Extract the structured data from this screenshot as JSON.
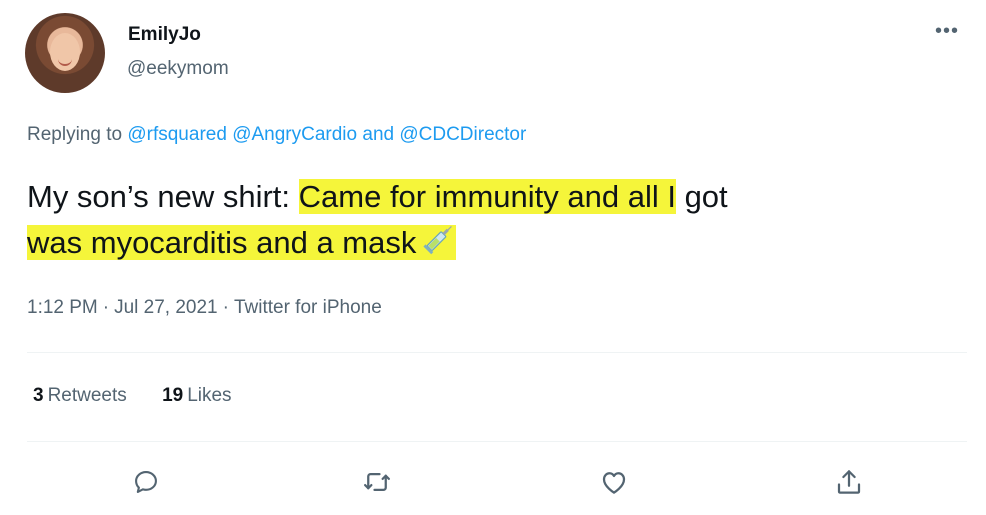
{
  "user": {
    "display_name": "EmilyJo",
    "handle": "@eekymom"
  },
  "more_icon": "more-horizontal-icon",
  "replying": {
    "prefix": "Replying to",
    "mentions": [
      "@rfsquared",
      "@AngryCardio",
      "@CDCDirector"
    ],
    "joiner": "and"
  },
  "tweet": {
    "text_plain": "My son’s new shirt: ",
    "text_highlighted_1": "Came for immunity and all I",
    "text_after_1": " got",
    "text_highlighted_2": "was myocarditis and a mask",
    "emoji": "syringe-icon",
    "highlight_color": "#f5f53a"
  },
  "meta": {
    "time": "1:12 PM",
    "date": "Jul 27, 2021",
    "source": "Twitter for iPhone",
    "separator": "·"
  },
  "stats": {
    "retweets_count": "3",
    "retweets_label": "Retweets",
    "likes_count": "19",
    "likes_label": "Likes"
  },
  "actions": [
    "reply-icon",
    "retweet-icon",
    "like-icon",
    "share-icon"
  ],
  "colors": {
    "text": "#0f1419",
    "secondary": "#536471",
    "link": "#1d9bf0",
    "divider": "#eff3f4"
  }
}
